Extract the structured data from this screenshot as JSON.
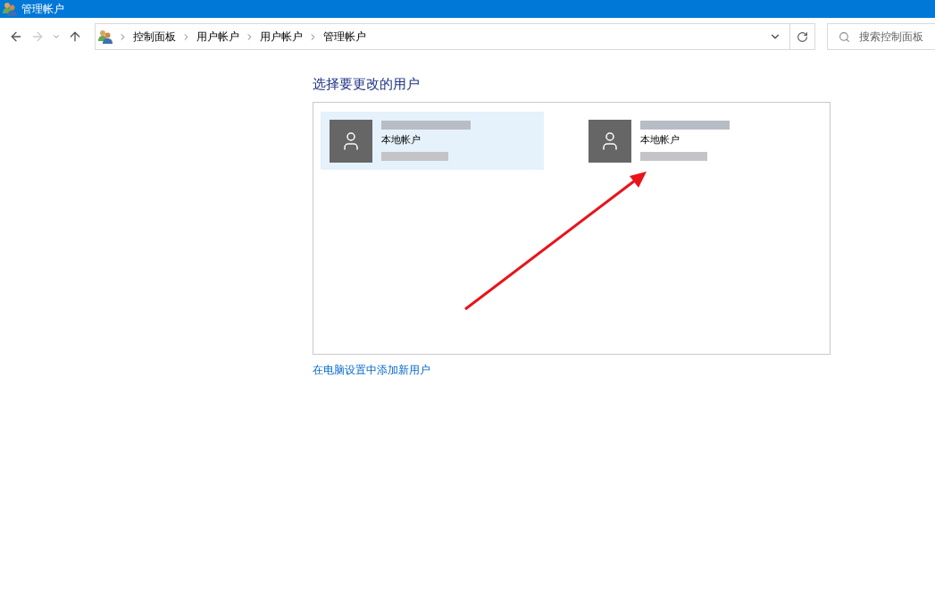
{
  "window": {
    "title": "管理帐户"
  },
  "address_bar": {
    "breadcrumbs": [
      "控制面板",
      "用户帐户",
      "用户帐户",
      "管理帐户"
    ]
  },
  "search": {
    "placeholder": "搜索控制面板"
  },
  "heading": "选择要更改的用户",
  "accounts": [
    {
      "type": "本地帐户",
      "selected": true
    },
    {
      "type": "本地帐户",
      "selected": false
    }
  ],
  "add_user_link": "在电脑设置中添加新用户"
}
